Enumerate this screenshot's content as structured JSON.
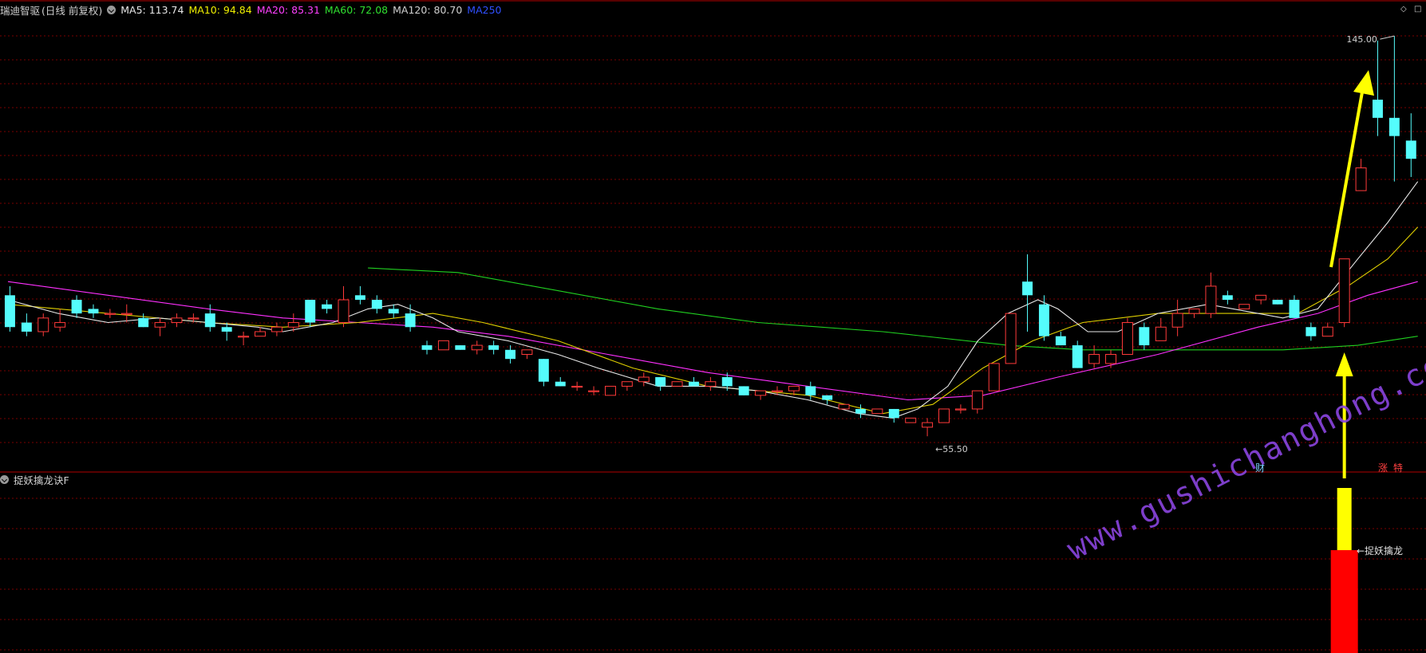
{
  "header": {
    "stock_name": "瑞迪智驱",
    "period_label": "(日线 前复权)",
    "ma_items": [
      {
        "label": "MA5:",
        "value": "113.74",
        "color": "#e8e8e8"
      },
      {
        "label": "MA10:",
        "value": "94.84",
        "color": "#f0f000"
      },
      {
        "label": "MA20:",
        "value": "85.31",
        "color": "#ff40ff"
      },
      {
        "label": "MA60:",
        "value": "72.08",
        "color": "#30e030"
      },
      {
        "label": "MA120:",
        "value": "80.70",
        "color": "#d0d0d0"
      },
      {
        "label": "MA250",
        "value": "",
        "color": "#3050ff"
      }
    ]
  },
  "indicator_panel": {
    "name": "捉妖擒龙诀F",
    "signal_label": "←捉妖擒龙"
  },
  "markers": {
    "fin": "财",
    "zhang": "涨",
    "te": "特"
  },
  "watermark": "www.gushichanghong.com",
  "colors": {
    "up": "#ff3a3a",
    "down": "#54fcfc",
    "arrow": "#ffff00",
    "grid": "#7a0000",
    "signal_yellow": "#ffff00",
    "signal_red": "#ff0000"
  },
  "icons": [
    "chevron-down-icon",
    "diamond-icon",
    "square-icon"
  ],
  "chart_data": {
    "type": "candlestick",
    "ylim": [
      53,
      148
    ],
    "high_label": "145.00",
    "low_label": "55.50",
    "candles": [
      [
        88,
        81,
        90,
        80
      ],
      [
        82,
        80,
        84,
        79
      ],
      [
        80,
        83,
        84,
        79
      ],
      [
        81,
        82,
        85,
        80
      ],
      [
        87,
        84,
        88,
        83
      ],
      [
        85,
        84,
        86,
        83
      ],
      [
        84,
        84,
        85,
        83
      ],
      [
        84,
        84,
        86,
        82
      ],
      [
        83,
        81,
        84,
        81
      ],
      [
        81,
        82,
        83,
        79
      ],
      [
        82,
        83,
        84,
        81
      ],
      [
        83,
        83,
        84,
        82
      ],
      [
        84,
        81,
        86,
        80
      ],
      [
        81,
        80,
        82,
        78
      ],
      [
        79,
        79,
        80,
        77
      ],
      [
        79,
        80,
        81,
        79
      ],
      [
        80,
        81,
        82,
        79
      ],
      [
        81,
        82,
        84,
        80
      ],
      [
        87,
        82,
        87,
        81
      ],
      [
        86,
        85,
        87,
        84
      ],
      [
        82,
        87,
        90,
        81
      ],
      [
        88,
        87,
        90,
        86
      ],
      [
        87,
        85,
        88,
        84
      ],
      [
        85,
        84,
        86,
        83
      ],
      [
        84,
        81,
        86,
        80
      ],
      [
        77,
        76,
        78,
        75
      ],
      [
        76,
        78,
        78,
        76
      ],
      [
        77,
        76,
        77,
        76
      ],
      [
        76,
        77,
        78,
        75
      ],
      [
        77,
        76,
        78,
        75
      ],
      [
        76,
        74,
        77,
        73
      ],
      [
        75,
        76,
        76,
        74
      ],
      [
        74,
        69,
        74,
        68
      ],
      [
        69,
        68,
        70,
        68
      ],
      [
        68,
        68,
        69,
        67
      ],
      [
        67,
        67,
        68,
        66
      ],
      [
        66,
        68,
        68,
        66
      ],
      [
        68,
        69,
        69,
        67
      ],
      [
        69,
        70,
        71,
        68
      ],
      [
        70,
        68,
        70,
        67
      ],
      [
        68,
        69,
        69,
        68
      ],
      [
        69,
        68,
        70,
        68
      ],
      [
        68,
        69,
        70,
        67
      ],
      [
        70,
        68,
        71,
        67
      ],
      [
        68,
        66,
        68,
        66
      ],
      [
        66,
        67,
        67,
        65
      ],
      [
        67,
        67,
        68,
        66
      ],
      [
        67,
        68,
        68,
        66
      ],
      [
        68,
        66,
        69,
        65
      ],
      [
        66,
        65,
        66,
        64
      ],
      [
        63,
        64,
        64,
        63
      ],
      [
        63,
        62,
        64,
        61
      ],
      [
        62,
        63,
        63,
        62
      ],
      [
        63,
        61,
        63,
        60
      ],
      [
        60,
        61,
        61,
        60
      ],
      [
        59,
        60,
        61,
        57
      ],
      [
        60,
        63,
        63,
        60
      ],
      [
        63,
        63,
        64,
        62
      ],
      [
        63,
        67,
        67,
        62
      ],
      [
        67,
        73,
        73,
        67
      ],
      [
        73,
        84,
        84,
        73
      ],
      [
        91,
        88,
        97,
        80
      ],
      [
        86,
        79,
        88,
        78
      ],
      [
        79,
        77,
        80,
        77
      ],
      [
        77,
        72,
        78,
        72
      ],
      [
        73,
        75,
        77,
        72
      ],
      [
        73,
        75,
        76,
        72
      ],
      [
        75,
        82,
        83,
        75
      ],
      [
        81,
        77,
        82,
        76
      ],
      [
        78,
        81,
        83,
        78
      ],
      [
        81,
        84,
        87,
        79
      ],
      [
        84,
        85,
        85,
        83
      ],
      [
        84,
        90,
        93,
        83
      ],
      [
        88,
        87,
        89,
        86
      ],
      [
        85,
        86,
        86,
        85
      ],
      [
        87,
        88,
        88,
        86
      ],
      [
        87,
        86,
        87,
        86
      ],
      [
        87,
        83,
        88,
        83
      ],
      [
        81,
        79,
        82,
        78
      ],
      [
        79,
        81,
        82,
        79
      ],
      [
        82,
        96,
        96,
        81
      ],
      [
        111,
        116,
        118,
        111
      ],
      [
        131,
        127,
        144,
        123
      ],
      [
        127,
        123,
        145,
        113
      ],
      [
        122,
        118,
        128,
        114
      ]
    ],
    "ma5": [
      [
        0,
        87
      ],
      [
        10,
        84
      ],
      [
        20,
        82
      ],
      [
        30,
        83
      ],
      [
        40,
        82
      ],
      [
        50,
        81
      ],
      [
        55,
        80
      ],
      [
        65,
        82
      ],
      [
        72,
        85
      ],
      [
        78,
        86
      ],
      [
        85,
        83
      ],
      [
        90,
        80
      ],
      [
        100,
        78
      ],
      [
        110,
        75
      ],
      [
        118,
        72
      ],
      [
        124,
        70
      ],
      [
        130,
        68
      ],
      [
        140,
        68
      ],
      [
        150,
        67
      ],
      [
        160,
        65
      ],
      [
        170,
        62
      ],
      [
        177,
        61
      ],
      [
        182,
        63
      ],
      [
        188,
        68
      ],
      [
        194,
        78
      ],
      [
        200,
        84
      ],
      [
        206,
        87
      ],
      [
        210,
        85
      ],
      [
        216,
        80
      ],
      [
        222,
        80
      ],
      [
        230,
        84
      ],
      [
        240,
        86
      ],
      [
        250,
        84
      ],
      [
        255,
        83
      ],
      [
        262,
        85
      ],
      [
        270,
        96
      ],
      [
        276,
        104
      ],
      [
        282,
        113
      ]
    ],
    "ma10": [
      [
        0,
        86
      ],
      [
        20,
        84
      ],
      [
        40,
        82
      ],
      [
        55,
        81
      ],
      [
        70,
        82
      ],
      [
        85,
        84
      ],
      [
        95,
        82
      ],
      [
        110,
        78
      ],
      [
        125,
        72
      ],
      [
        140,
        68
      ],
      [
        160,
        66
      ],
      [
        175,
        62
      ],
      [
        185,
        64
      ],
      [
        195,
        72
      ],
      [
        205,
        78
      ],
      [
        215,
        82
      ],
      [
        230,
        84
      ],
      [
        245,
        84
      ],
      [
        258,
        84
      ],
      [
        268,
        90
      ],
      [
        276,
        96
      ],
      [
        282,
        103
      ]
    ],
    "ma20": [
      [
        0,
        91
      ],
      [
        20,
        88
      ],
      [
        40,
        85
      ],
      [
        55,
        83
      ],
      [
        70,
        82
      ],
      [
        85,
        81
      ],
      [
        100,
        79
      ],
      [
        120,
        75
      ],
      [
        140,
        71
      ],
      [
        160,
        68
      ],
      [
        180,
        65
      ],
      [
        195,
        66
      ],
      [
        210,
        70
      ],
      [
        230,
        75
      ],
      [
        250,
        81
      ],
      [
        262,
        84
      ],
      [
        272,
        88
      ],
      [
        282,
        91
      ]
    ],
    "ma60": [
      [
        72,
        94
      ],
      [
        90,
        93
      ],
      [
        110,
        89
      ],
      [
        130,
        85
      ],
      [
        150,
        82
      ],
      [
        175,
        80
      ],
      [
        200,
        77
      ],
      [
        215,
        76
      ],
      [
        235,
        76
      ],
      [
        255,
        76
      ],
      [
        270,
        77
      ],
      [
        282,
        79
      ]
    ]
  }
}
